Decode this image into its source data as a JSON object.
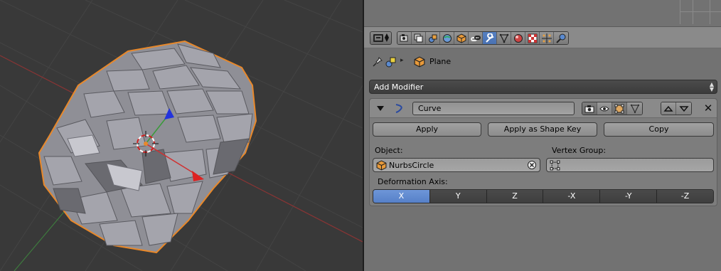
{
  "viewport": {
    "object_outline_color": "#e8882a",
    "mesh_color": "#9a9aa0"
  },
  "properties": {
    "editor_type_icon": "properties-editor-icon",
    "context_tabs": [
      {
        "name": "render-icon",
        "active": false
      },
      {
        "name": "render-layers-icon",
        "active": false
      },
      {
        "name": "scene-icon",
        "active": false
      },
      {
        "name": "world-icon",
        "active": false
      },
      {
        "name": "object-icon",
        "active": false
      },
      {
        "name": "constraints-icon",
        "active": false
      },
      {
        "name": "modifiers-wrench-icon",
        "active": true
      },
      {
        "name": "object-data-icon",
        "active": false
      },
      {
        "name": "material-icon",
        "active": false
      },
      {
        "name": "texture-icon",
        "active": false
      },
      {
        "name": "particles-icon",
        "active": false
      },
      {
        "name": "physics-icon",
        "active": false
      }
    ],
    "breadcrumb": {
      "object_name": "Plane"
    },
    "add_modifier_label": "Add Modifier",
    "modifier": {
      "name": "Curve",
      "buttons": {
        "apply": "Apply",
        "apply_shape_key": "Apply as Shape Key",
        "copy": "Copy"
      },
      "object_label": "Object:",
      "object_value": "NurbsCircle",
      "vertex_group_label": "Vertex Group:",
      "vertex_group_value": "",
      "deformation_axis_label": "Deformation Axis:",
      "axes": [
        "X",
        "Y",
        "Z",
        "-X",
        "-Y",
        "-Z"
      ],
      "active_axis": "X"
    }
  }
}
